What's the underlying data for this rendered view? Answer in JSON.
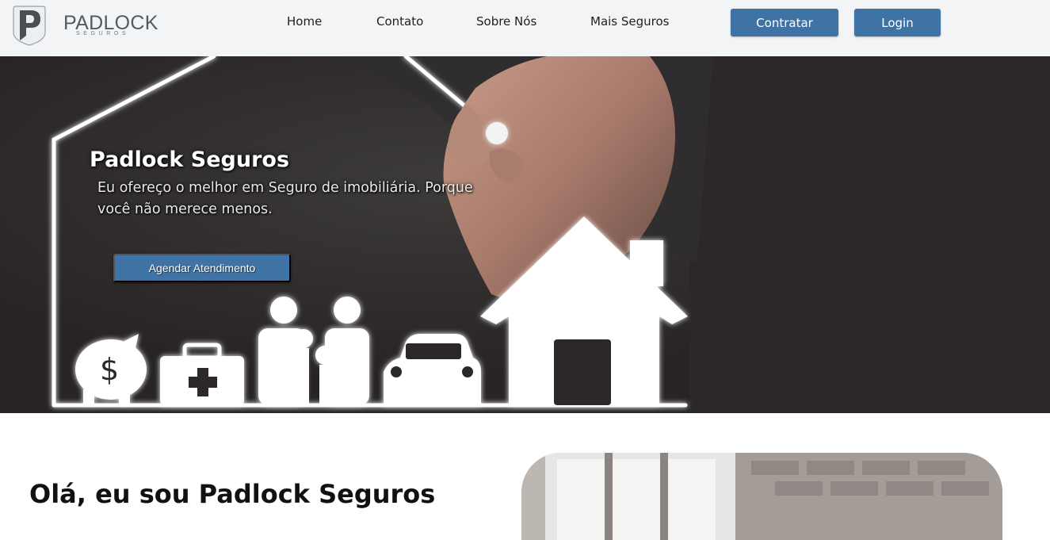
{
  "header": {
    "logo": {
      "brand": "PADLOCK",
      "tagline": "SEGUROS",
      "icon": "padlock-p-logo-icon"
    },
    "nav": [
      {
        "label": "Home"
      },
      {
        "label": "Contato"
      },
      {
        "label": "Sobre Nós"
      },
      {
        "label": "Mais Seguros"
      }
    ],
    "buttons": {
      "contratar": "Contratar",
      "login": "Login"
    }
  },
  "hero": {
    "title": "Padlock Seguros",
    "subtitle": "Eu ofereço o melhor em Seguro de imobiliária. Porque você não merece menos.",
    "cta": "Agendar Atendimento",
    "image_icon": "hand-drawing-house-family-insurance-illustration"
  },
  "about": {
    "heading": "Olá, eu sou Padlock Seguros",
    "image_icon": "interior-room-photo"
  },
  "colors": {
    "accent": "#3f73a5",
    "navbar_bg": "#f2f4f6",
    "hero_bg": "#2b2827"
  }
}
